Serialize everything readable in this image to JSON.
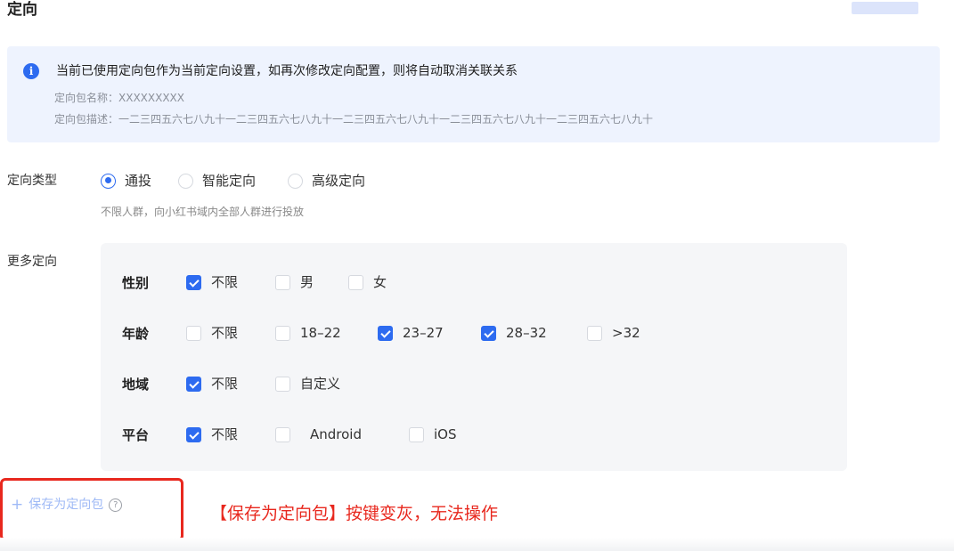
{
  "section_title": "定向",
  "notice": {
    "message": "当前已使用定向包作为当前定向设置，如再次修改定向配置，则将自动取消关联关系",
    "package_name": "定向包名称：XXXXXXXXX",
    "package_desc": "定向包描述：一二三四五六七八九十一二三四五六七八九十一二三四五六七八九十一二三四五六七八九十一二三四五六七八九十",
    "icon": "info-icon"
  },
  "target_type": {
    "label": "定向类型",
    "options": [
      {
        "label": "通投",
        "checked": true
      },
      {
        "label": "智能定向",
        "checked": false
      },
      {
        "label": "高级定向",
        "checked": false
      }
    ],
    "hint": "不限人群，向小红书域内全部人群进行投放"
  },
  "more_targeting": {
    "label": "更多定向",
    "rows": [
      {
        "label": "性别",
        "options": [
          {
            "label": "不限",
            "checked": true
          },
          {
            "label": "男",
            "checked": false
          },
          {
            "label": "女",
            "checked": false
          }
        ]
      },
      {
        "label": "年龄",
        "options": [
          {
            "label": "不限",
            "checked": false
          },
          {
            "label": "18–22",
            "checked": false
          },
          {
            "label": "23–27",
            "checked": true
          },
          {
            "label": "28–32",
            "checked": true
          },
          {
            "label": ">32",
            "checked": false
          }
        ]
      },
      {
        "label": "地域",
        "options": [
          {
            "label": "不限",
            "checked": true
          },
          {
            "label": "自定义",
            "checked": false
          }
        ]
      },
      {
        "label": "平台",
        "options": [
          {
            "label": "不限",
            "checked": true
          },
          {
            "label": "Android",
            "checked": false
          },
          {
            "label": "iOS",
            "checked": false
          }
        ]
      }
    ]
  },
  "save_package": {
    "plus": "+",
    "label": "保存为定向包",
    "help": "?"
  },
  "annotation": "【保存为定向包】按键变灰，无法操作",
  "colors": {
    "accent": "#2d6bf0",
    "notice_bg": "#eef3fe",
    "disabled_link": "#9fbaf6",
    "annotation_red": "#e8281e"
  }
}
